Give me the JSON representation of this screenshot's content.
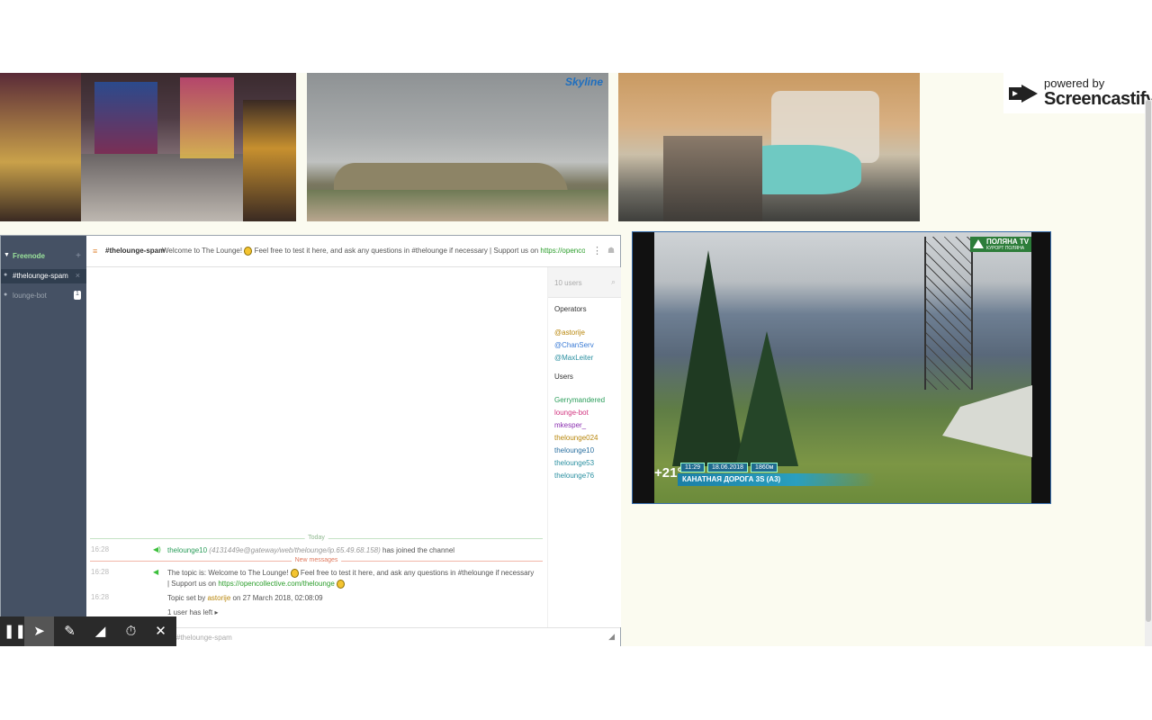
{
  "screencastify": {
    "powered": "powered by",
    "brand": "Screencastify"
  },
  "cams": {
    "athens_logo": "Skyline"
  },
  "lounge": {
    "network": "Freenode",
    "channels": [
      {
        "label": "#thelounge-spam",
        "close": "×"
      },
      {
        "label": "lounge-bot",
        "badge": "1"
      }
    ],
    "topbar": {
      "channel": "#thelounge-spam",
      "topic_a": "Welcome to The Lounge!",
      "topic_b": "Feel free to test it here, and ask any questions in #thelounge if necessary | Support us on",
      "topic_link": "https://opencollective.com/thelounge"
    },
    "users": {
      "search_placeholder": "10 users",
      "operators_label": "Operators",
      "operators": [
        "@astorije",
        "@ChanServ",
        "@MaxLeiter"
      ],
      "users_label": "Users",
      "list": [
        "Gerrymandered",
        "lounge-bot",
        "mkesper_",
        "thelounge024",
        "thelounge10",
        "thelounge53",
        "thelounge76"
      ]
    },
    "messages": {
      "today": "Today",
      "new_messages": "New messages",
      "join_time": "16:28",
      "join_nick": "thelounge10",
      "join_host": "(4131449e@gateway/web/thelounge/ip.65.49.68.158)",
      "join_text": "has joined the channel",
      "topic_time": "16:28",
      "topic_prefix": "The topic is: Welcome to The Lounge!",
      "topic_suffix": "Feel free to test it here, and ask any questions in #thelounge if necessary | Support us on",
      "topic_link": "https://opencollective.com/thelounge",
      "topicset_time": "16:28",
      "topicset_prefix": "Topic set by",
      "topicset_nick": "astorije",
      "topicset_suffix": "on 27 March 2018, 02:08:09",
      "left": "1 user has left"
    },
    "input_placeholder": "#thelounge-spam"
  },
  "polyana": {
    "logo": "ПОЛЯНА TV",
    "logo_sub": "КУРОРТ ПОЛЯНА",
    "temp": "+21°",
    "time": "11:29",
    "date": "18.06.2018",
    "alt": "1860м",
    "caption": "КАНАТНАЯ ДОРОГА 3S (A3)"
  },
  "toolbar": {
    "pause": "❚❚",
    "pointer": "➤",
    "pen": "✎",
    "eraser": "◢",
    "timer": "⏱",
    "close": "✕"
  },
  "colors": {
    "sidebar": "#455164",
    "accent_green": "#2a9d2a",
    "operator_orange": "#b8860b"
  }
}
